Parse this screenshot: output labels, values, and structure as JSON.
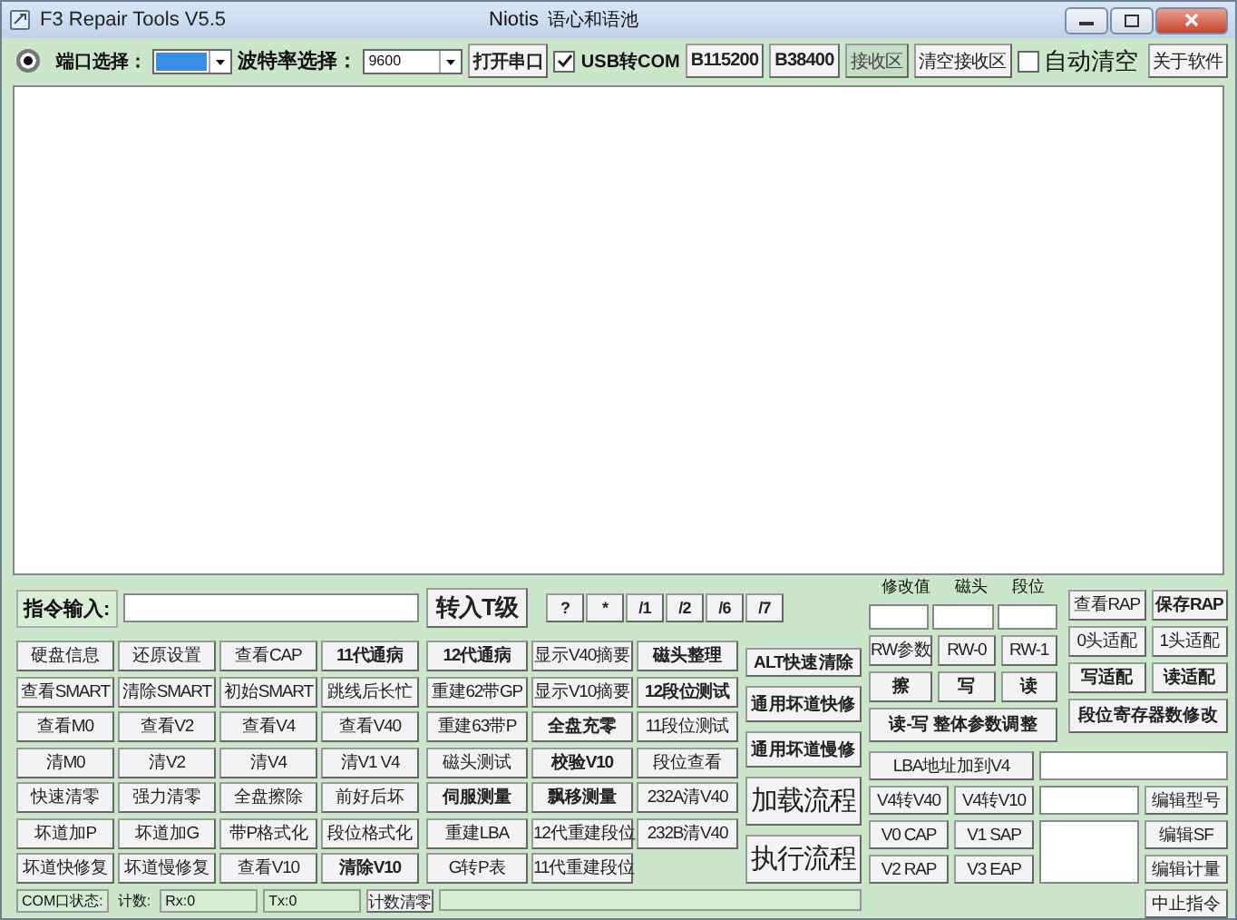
{
  "window": {
    "title": "F3 Repair Tools V5.5",
    "author": "Niotis",
    "motto": "语心和语池"
  },
  "toolbar": {
    "radio": {
      "selected": true
    },
    "port_label": "端口选择：",
    "baud_label": "波特率选择：",
    "baud_value": "9600",
    "open_button": "打开串口",
    "usb_com": {
      "label": "USB转COM",
      "checked": true
    },
    "buttons": [
      {
        "label": "B115200",
        "pressed": false
      },
      {
        "label": "B38400",
        "pressed": false
      },
      {
        "label": "接收区",
        "pressed": true
      },
      {
        "label": "清空接收区",
        "pressed": false
      }
    ],
    "auto_clear": {
      "label": "自动清空",
      "checked": false
    },
    "about_button": "关于软件"
  },
  "command": {
    "label": "指令输入:",
    "to_t_button": "转入T级",
    "symbols": [
      "?",
      "*",
      "/1",
      "/2",
      "/6",
      "/7"
    ]
  },
  "left_grid": [
    {
      "label": "硬盘信息",
      "bold": false
    },
    {
      "label": "还原设置",
      "bold": false
    },
    {
      "label": "查看CAP",
      "bold": false
    },
    {
      "label": "11代通病",
      "bold": true
    },
    {
      "label": "查看SMART",
      "bold": false
    },
    {
      "label": "清除SMART",
      "bold": false
    },
    {
      "label": "初始SMART",
      "bold": false
    },
    {
      "label": "跳线后长忙",
      "bold": false
    },
    {
      "label": "查看M0",
      "bold": false
    },
    {
      "label": "查看V2",
      "bold": false
    },
    {
      "label": "查看V4",
      "bold": false
    },
    {
      "label": "查看V40",
      "bold": false
    },
    {
      "label": "清M0",
      "bold": false
    },
    {
      "label": "清V2",
      "bold": false
    },
    {
      "label": "清V4",
      "bold": false
    },
    {
      "label": "清V1 V4",
      "bold": false
    },
    {
      "label": "快速清零",
      "bold": false
    },
    {
      "label": "强力清零",
      "bold": false
    },
    {
      "label": "全盘擦除",
      "bold": false
    },
    {
      "label": "前好后坏",
      "bold": false
    },
    {
      "label": "坏道加P",
      "bold": false
    },
    {
      "label": "坏道加G",
      "bold": false
    },
    {
      "label": "带P格式化",
      "bold": false
    },
    {
      "label": "段位格式化",
      "bold": false
    },
    {
      "label": "坏道快修复",
      "bold": false
    },
    {
      "label": "坏道慢修复",
      "bold": false
    },
    {
      "label": "查看V10",
      "bold": false
    },
    {
      "label": "清除V10",
      "bold": true
    }
  ],
  "mid_grid": [
    {
      "label": "12代通病",
      "bold": true
    },
    {
      "label": "显示V40摘要",
      "bold": false
    },
    {
      "label": "磁头整理",
      "bold": true
    },
    {
      "label": "重建62带GP",
      "bold": false
    },
    {
      "label": "显示V10摘要",
      "bold": false
    },
    {
      "label": "12段位测试",
      "bold": true
    },
    {
      "label": "重建63带P",
      "bold": false
    },
    {
      "label": "全盘充零",
      "bold": true
    },
    {
      "label": "11段位测试",
      "bold": false
    },
    {
      "label": "磁头测试",
      "bold": false
    },
    {
      "label": "校验V10",
      "bold": true
    },
    {
      "label": "段位查看",
      "bold": false
    },
    {
      "label": "伺服测量",
      "bold": true
    },
    {
      "label": "飘移测量",
      "bold": true
    },
    {
      "label": "232A清V40",
      "bold": false
    },
    {
      "label": "重建LBA",
      "bold": false
    },
    {
      "label": "12代重建段位",
      "bold": false
    },
    {
      "label": "232B清V40",
      "bold": false
    },
    {
      "label": "G转P表",
      "bold": false
    },
    {
      "label": "11代重建段位",
      "bold": false
    }
  ],
  "flow_buttons": [
    {
      "label": "ALT快速清除",
      "kind": "small"
    },
    {
      "label": "通用坏道快修",
      "kind": "medium"
    },
    {
      "label": "通用坏道慢修",
      "kind": "medium"
    },
    {
      "label": "加载流程",
      "kind": "large"
    },
    {
      "label": "执行流程",
      "kind": "large"
    }
  ],
  "params": {
    "labels": [
      "修改值",
      "磁头",
      "段位"
    ],
    "rw": [
      {
        "label": "RW参数",
        "bold": false
      },
      {
        "label": "RW-0",
        "bold": false
      },
      {
        "label": "RW-1",
        "bold": false
      },
      {
        "label": "擦",
        "bold": true
      },
      {
        "label": "写",
        "bold": true
      },
      {
        "label": "读",
        "bold": true
      }
    ],
    "adjust_button": "读-写  整体参数调整"
  },
  "adapt": [
    {
      "label": "查看RAP",
      "bold": false
    },
    {
      "label": "保存RAP",
      "bold": true
    },
    {
      "label": "0头适配",
      "bold": false
    },
    {
      "label": "1头适配",
      "bold": false
    },
    {
      "label": "写适配",
      "bold": true
    },
    {
      "label": "读适配",
      "bold": true
    }
  ],
  "register_button": "段位寄存器数修改",
  "lba_button": "LBA地址加到V4",
  "convert": [
    "V4转V40",
    "V4转V10"
  ],
  "model_button": "编辑型号",
  "module_rows": [
    {
      "buttons": [
        "V0 CAP",
        "V1 SAP"
      ],
      "edit": "编辑SF"
    },
    {
      "buttons": [
        "V2 RAP",
        "V3 EAP"
      ],
      "edit": "编辑计量"
    }
  ],
  "abort_button": "中止指令",
  "status": {
    "com_label": "COM口状态:",
    "count_label": "计数:",
    "rx": "Rx:0",
    "tx": "Tx:0",
    "reset_button": "计数清零"
  }
}
